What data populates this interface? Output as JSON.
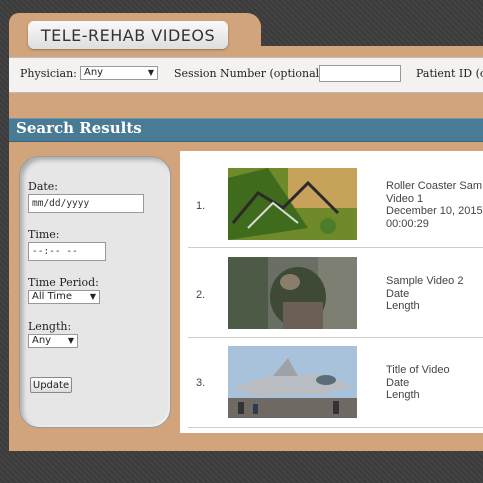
{
  "header": {
    "tab_title": "TELE-REHAB VIDEOS"
  },
  "filters": {
    "physician_label": "Physician:",
    "physician_value": "Any",
    "session_label": "Session Number (optional):",
    "session_value": "",
    "patient_label": "Patient ID (o"
  },
  "search_results": {
    "title": "Search Results"
  },
  "sidebar": {
    "date_label": "Date:",
    "date_placeholder": "mm/dd/yyyy",
    "time_label": "Time:",
    "time_placeholder": "--:-- --",
    "period_label": "Time Period:",
    "period_value": "All Time",
    "length_label": "Length:",
    "length_value": "Any",
    "update_button": "Update"
  },
  "videos": [
    {
      "index": "1.",
      "title": "Roller Coaster Sam",
      "line2": "Video 1",
      "line3": "December 10, 2015",
      "line4": "00:00:29"
    },
    {
      "index": "2.",
      "title": "Sample Video 2",
      "line2": "Date",
      "line3": "Length"
    },
    {
      "index": "3.",
      "title": "Title of Video",
      "line2": "Date",
      "line3": "Length"
    }
  ],
  "colors": {
    "panel": "#d2a47b",
    "header_bar": "#4a7b94",
    "background": "#3d3d3d"
  }
}
